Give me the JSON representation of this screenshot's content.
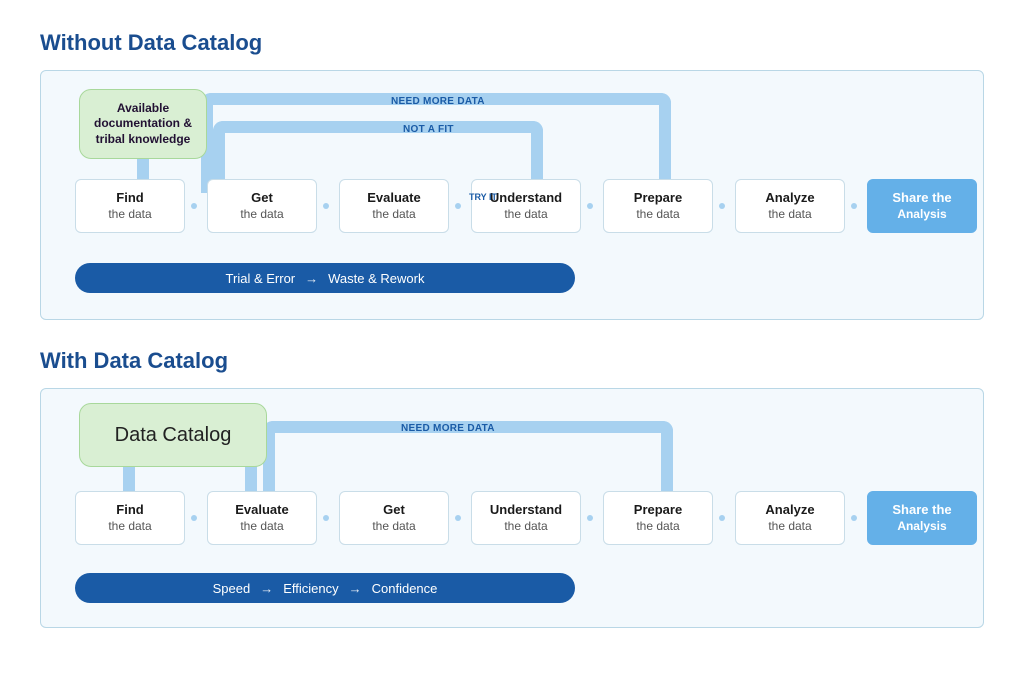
{
  "sections": {
    "without": {
      "title": "Without Data Catalog",
      "catalog_label": "Available documentation & tribal knowledge",
      "loops": {
        "need_more_data": "NEED MORE DATA",
        "not_a_fit": "NOT A FIT",
        "try_it": "TRY IT"
      },
      "steps": [
        {
          "bold": "Find",
          "sub": "the data"
        },
        {
          "bold": "Get",
          "sub": "the data"
        },
        {
          "bold": "Evaluate",
          "sub": "the data"
        },
        {
          "bold": "Understand",
          "sub": "the data"
        },
        {
          "bold": "Prepare",
          "sub": "the data"
        },
        {
          "bold": "Analyze",
          "sub": "the data"
        },
        {
          "bold": "Share the",
          "sub": "Analysis"
        }
      ],
      "pill": {
        "a": "Trial & Error",
        "b": "Waste & Rework"
      }
    },
    "with": {
      "title": "With Data Catalog",
      "catalog_label": "Data Catalog",
      "loops": {
        "need_more_data": "NEED MORE DATA"
      },
      "steps": [
        {
          "bold": "Find",
          "sub": "the data"
        },
        {
          "bold": "Evaluate",
          "sub": "the data"
        },
        {
          "bold": "Get",
          "sub": "the data"
        },
        {
          "bold": "Understand",
          "sub": "the data"
        },
        {
          "bold": "Prepare",
          "sub": "the data"
        },
        {
          "bold": "Analyze",
          "sub": "the data"
        },
        {
          "bold": "Share the",
          "sub": "Analysis"
        }
      ],
      "pill": {
        "a": "Speed",
        "b": "Efficiency",
        "c": "Confidence"
      }
    }
  }
}
